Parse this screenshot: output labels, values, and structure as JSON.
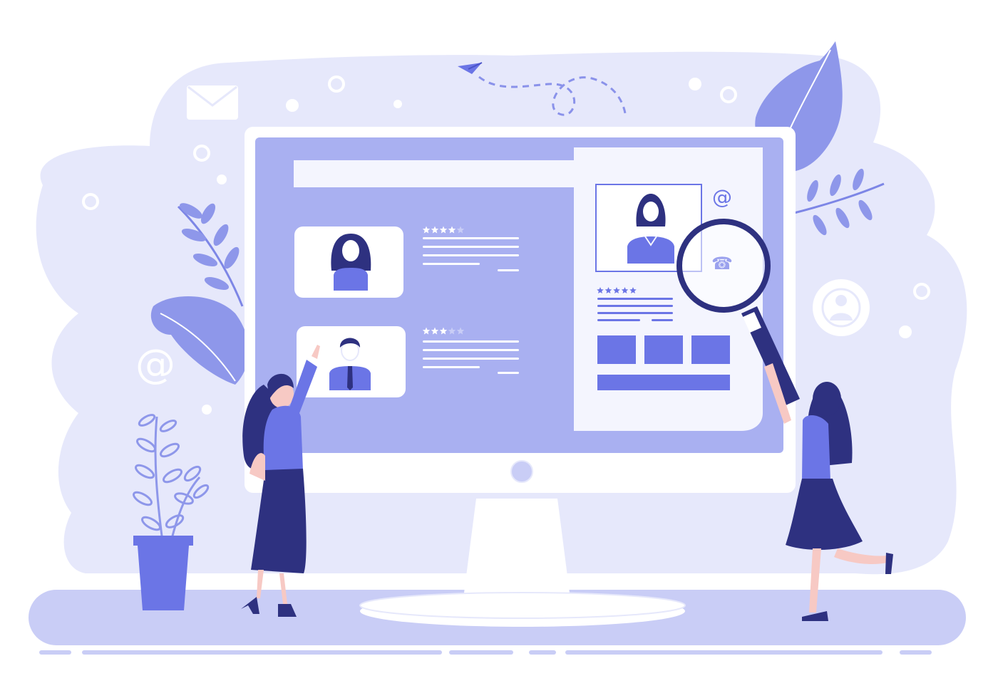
{
  "colors": {
    "background": "#ffffff",
    "backdrop_blob": "#e6e8fb",
    "floor": "#c9cdf6",
    "screen": "#a9b0f1",
    "screen_light": "#f4f5fe",
    "accent": "#6b75e6",
    "dark_navy": "#2e3180",
    "skin": "#f7c9c4",
    "leaf": "#7d86e6",
    "leaf_light": "#bfc4f4"
  },
  "icons": {
    "at_sign": "@",
    "phone": "☎"
  },
  "profiles": [
    {
      "name": "candidate-card-woman",
      "rating_filled": 4,
      "rating_total": 5
    },
    {
      "name": "candidate-card-man",
      "rating_filled": 3,
      "rating_total": 5
    }
  ],
  "selected_profile": {
    "rating_filled": 5,
    "rating_total": 5
  }
}
